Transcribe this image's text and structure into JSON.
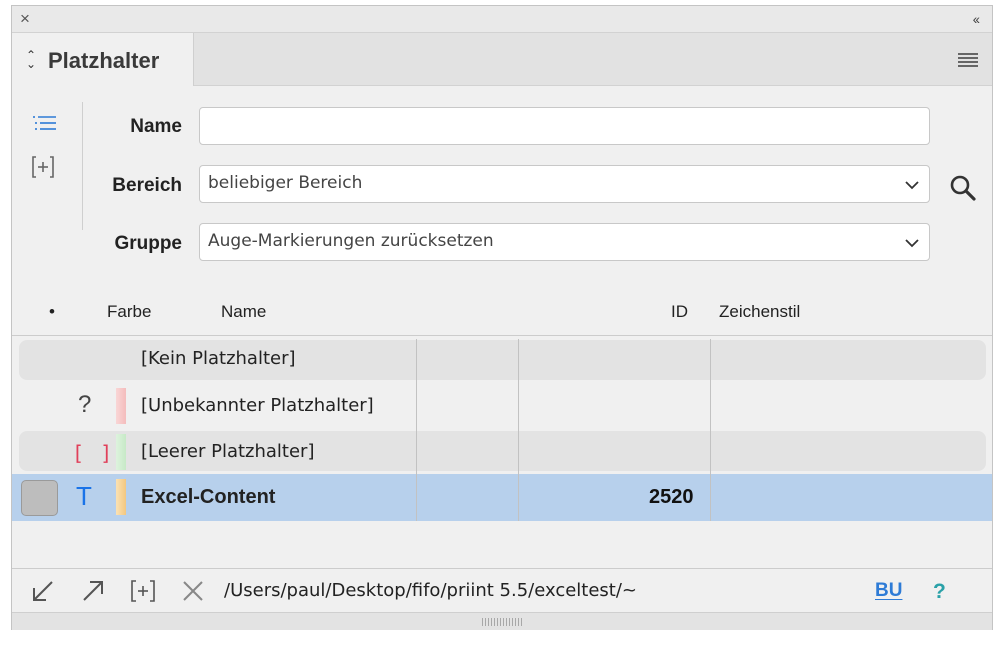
{
  "window": {
    "close_glyph": "×",
    "collapse_glyph": "‹‹"
  },
  "tab": {
    "label": "Platzhalter"
  },
  "form": {
    "name_label": "Name",
    "name_value": "",
    "bereich_label": "Bereich",
    "bereich_value": "beliebiger Bereich",
    "gruppe_label": "Gruppe",
    "gruppe_value": "Auge-Markierungen zurücksetzen"
  },
  "table": {
    "headers": {
      "dot": "•",
      "farbe": "Farbe",
      "name": "Name",
      "id": "ID",
      "zeichenstil": "Zeichenstil"
    },
    "rows": [
      {
        "icon": "",
        "color": "",
        "name": "[Kein Platzhalter]",
        "id": "",
        "style": ""
      },
      {
        "icon": "?",
        "color": "#f8c9c9",
        "name": "[Unbekannter Platzhalter]",
        "id": "",
        "style": ""
      },
      {
        "icon": "[ ]",
        "color": "#cdeccd",
        "name": "[Leerer Platzhalter]",
        "id": "",
        "style": ""
      },
      {
        "icon": "T",
        "color": "#f7d49a",
        "name": "Excel-Content",
        "id": "2520",
        "style": ""
      }
    ]
  },
  "footer": {
    "path": "/Users/paul/Desktop/fifo/priint 5.5/exceltest/~",
    "bu_label": "BU",
    "help_label": "?"
  },
  "icons": [
    "close-icon",
    "collapse-icon",
    "tab-arrows-icon",
    "panel-menu-icon",
    "list-view-icon",
    "add-icon",
    "search-icon",
    "chevron-down-icon",
    "arrow-down-left-icon",
    "arrow-up-right-icon",
    "add-frame-icon",
    "delete-icon"
  ]
}
